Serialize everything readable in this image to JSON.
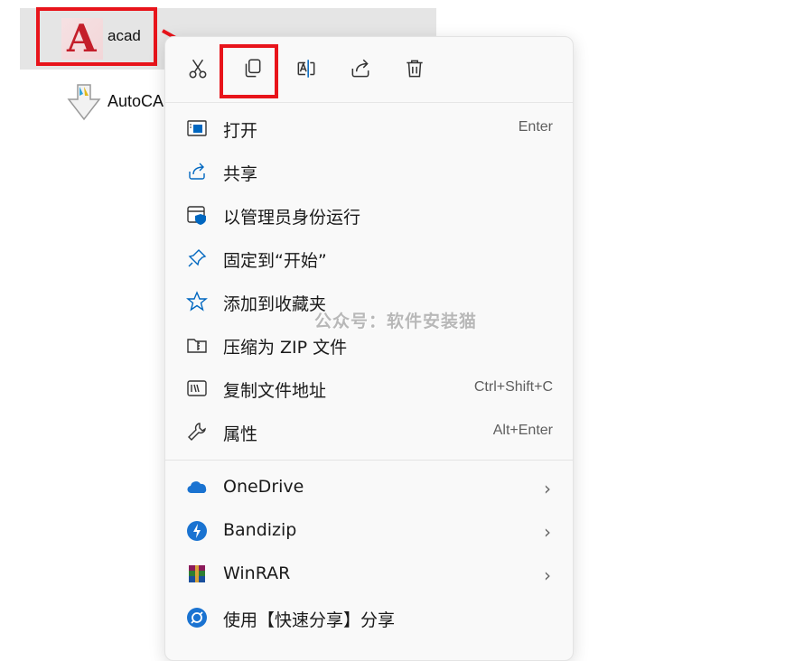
{
  "desktop": {
    "acad_label": "acad",
    "installer_label": "AutoCAD"
  },
  "toolbar": {
    "cut": "cut-icon",
    "copy": "copy-icon",
    "rename": "rename-icon",
    "share": "share-icon",
    "delete": "delete-icon"
  },
  "menu": {
    "items": [
      {
        "label": "打开",
        "shortcut": "Enter",
        "icon": "open-icon"
      },
      {
        "label": "共享",
        "shortcut": "",
        "icon": "share-icon"
      },
      {
        "label": "以管理员身份运行",
        "shortcut": "",
        "icon": "run-as-admin-icon"
      },
      {
        "label": "固定到“开始”",
        "shortcut": "",
        "icon": "pin-icon"
      },
      {
        "label": "添加到收藏夹",
        "shortcut": "",
        "icon": "star-icon"
      },
      {
        "label": "压缩为 ZIP 文件",
        "shortcut": "",
        "icon": "zip-icon"
      },
      {
        "label": "复制文件地址",
        "shortcut": "Ctrl+Shift+C",
        "icon": "copy-path-icon"
      },
      {
        "label": "属性",
        "shortcut": "Alt+Enter",
        "icon": "wrench-icon"
      }
    ],
    "apps": [
      {
        "label": "OneDrive",
        "icon": "onedrive-icon",
        "submenu": "›"
      },
      {
        "label": "Bandizip",
        "icon": "bandizip-icon",
        "submenu": "›"
      },
      {
        "label": "WinRAR",
        "icon": "winrar-icon",
        "submenu": "›"
      },
      {
        "label": "使用【快速分享】分享",
        "icon": "quick-share-icon",
        "submenu": ""
      }
    ]
  },
  "watermark": "公众号：软件安装猫",
  "colors": {
    "highlight": "#e8141b",
    "accent": "#0067c0"
  }
}
